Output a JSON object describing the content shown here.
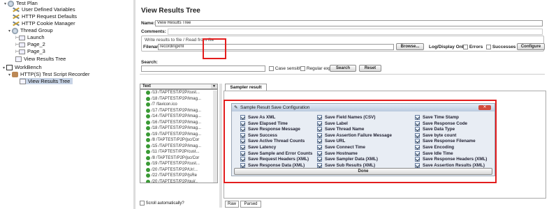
{
  "tree": {
    "top_item": "Test Plan",
    "items": [
      {
        "label": "User Defined Variables",
        "icon": "wrench-icon"
      },
      {
        "label": "HTTP Request Defaults",
        "icon": "wrench-icon"
      },
      {
        "label": "HTTP Cookie Manager",
        "icon": "wrench-icon"
      },
      {
        "label": "Thread Group",
        "icon": "gear-icon"
      },
      {
        "label": "Launch",
        "icon": "sampler-icon"
      },
      {
        "label": "Page_2",
        "icon": "sampler-icon"
      },
      {
        "label": "Page_3",
        "icon": "sampler-icon"
      },
      {
        "label": "View Results Tree",
        "icon": "listener-icon"
      },
      {
        "label": "WorkBench",
        "icon": "workbench-icon"
      },
      {
        "label": "HTTP(S) Test Script Recorder",
        "icon": "recorder-icon"
      },
      {
        "label": "View Results Tree",
        "icon": "listener-icon"
      }
    ]
  },
  "panel": {
    "title": "View Results Tree",
    "name_label": "Name:",
    "name_value": "View Results Tree",
    "comments_label": "Comments:",
    "write_label": "Write results to file / Read from file",
    "filename_label": "Filename",
    "filename_value": "recordingxml",
    "browse": "Browse...",
    "log_only": "Log/Display Only:",
    "errors": "Errors",
    "successes": "Successes",
    "configure": "Configure",
    "search_label": "Search:",
    "case_sensitive": "Case sensitive",
    "regular_exp": "Regular exp.",
    "search_btn": "Search",
    "reset_btn": "Reset",
    "text_combo": "Text",
    "tab": "Sampler result",
    "scroll_auto": "Scroll automatically?",
    "bottom_tabs": [
      "Raw",
      "Parsed"
    ]
  },
  "sample_list": [
    "/13 /TAPTEST/P2P/cust...",
    "/18 /TAPTEST/P2P/imag...",
    "/7 /favicon.ico",
    "/17 /TAPTEST/P2P/imag...",
    "/14 /TAPTEST/P2P/imag...",
    "/16 /TAPTEST/P2P/imag...",
    "/18 /TAPTEST/P2P/imag...",
    "/19 /TAPTEST/P2P/imag...",
    "/8 /TAPTEST/P2P/jsc/Cor",
    "/15 /TAPTEST/P2P/imag...",
    "/11 /TAPTEST/P2P/cust...",
    "/8 /TAPTEST/P2P/jsc/Cor",
    "/19 /TAPTEST/P2P/cust...",
    "/20 /TAPTEST/P2P/Ur/...",
    "/22 /TAPTEST/P2P/jsRe",
    "/20 /TAPTEST/P2P/qui/..",
    "/23 /TAPTEST/P2P/cust/",
    "/24 /TAPTEST/P2P/UCo",
    "/26 /TAPTEST/P2P/cust/"
  ],
  "dialog": {
    "title": "Sample Result Save Configuration",
    "done": "Done",
    "columns": [
      [
        "Save As XML",
        "Save Elapsed Time",
        "Save Response Message",
        "Save Success",
        "Save Active Thread Counts",
        "Save Latency",
        "Save Sample and Error Counts",
        "Save Request Headers (XML)",
        "Save Response Data (XML)"
      ],
      [
        "Save Field Names (CSV)",
        "Save Label",
        "Save Thread Name",
        "Save Assertion Failure Message",
        "Save URL",
        "Save Connect Time",
        "Save Hostname",
        "Save Sampler Data (XML)",
        "Save Sub Results (XML)"
      ],
      [
        "Save Time Stamp",
        "Save Response Code",
        "Save Data Type",
        "Save byte count",
        "Save Response Filename",
        "Save Encoding",
        "Save Idle Time",
        "Save Response Headers (XML)",
        "Save Assertion Results (XML)"
      ]
    ]
  },
  "colors": {
    "highlight": "#e31d1d",
    "selection": "#c8d4e6",
    "dialog_bg": "#e8edf4"
  }
}
